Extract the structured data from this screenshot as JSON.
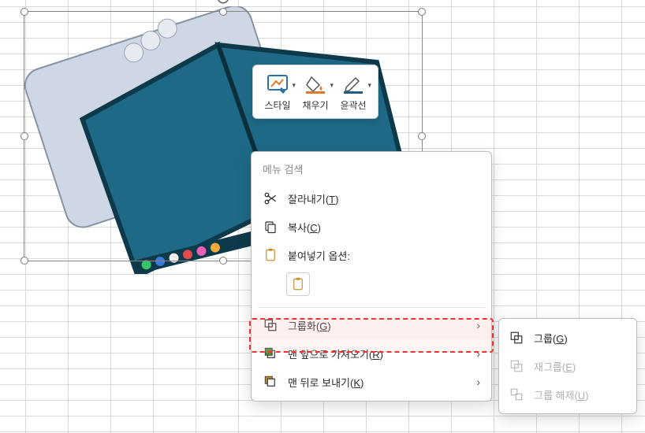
{
  "toolbar": {
    "style_label": "스타일",
    "fill_label": "채우기",
    "outline_label": "윤곽선",
    "fill_color": "#e07b2e",
    "outline_color": "#1f5f87"
  },
  "menu": {
    "search_placeholder": "메뉴 검색",
    "cut_label": "잘라내기(",
    "cut_key": "T",
    "cut_close": ")",
    "copy_label": "복사(",
    "copy_key": "C",
    "copy_close": ")",
    "paste_options_label": "붙여넣기 옵션:",
    "group_label": "그룹화(",
    "group_key": "G",
    "group_close": ")",
    "bring_front_label": "맨 앞으로 가져오기(",
    "bring_front_key": "R",
    "bring_front_close": ")",
    "send_back_label": "맨 뒤로 보내기(",
    "send_back_key": "K",
    "send_back_close": ")"
  },
  "submenu": {
    "group_label": "그룹(",
    "group_key": "G",
    "group_close": ")",
    "regroup_label": "재그룹(",
    "regroup_key": "E",
    "regroup_close": ")",
    "ungroup_label": "그룹 해제(",
    "ungroup_key": "U",
    "ungroup_close": ")"
  },
  "phone": {
    "screen_color": "#1e6a86",
    "body_color": "#cfd7e4"
  }
}
